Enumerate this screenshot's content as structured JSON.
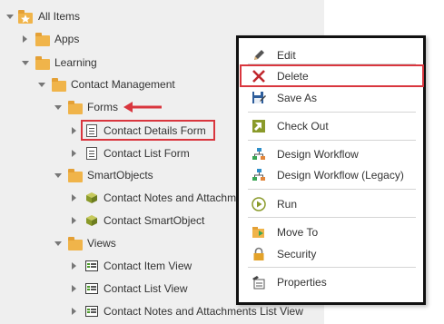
{
  "tree": {
    "root": {
      "label": "All Items",
      "icon": "star-folder-icon"
    },
    "apps": {
      "label": "Apps",
      "icon": "folder-icon"
    },
    "learning": {
      "label": "Learning",
      "icon": "folder-icon"
    },
    "contact_management": {
      "label": "Contact Management",
      "icon": "folder-icon"
    },
    "forms": {
      "label": "Forms",
      "icon": "folder-icon"
    },
    "contact_details_form": {
      "label": "Contact Details Form",
      "icon": "form-icon"
    },
    "contact_list_form": {
      "label": "Contact List Form",
      "icon": "form-icon"
    },
    "smartobjects": {
      "label": "SmartObjects",
      "icon": "folder-icon"
    },
    "contact_notes_so": {
      "label": "Contact Notes and Attachm",
      "icon": "smartobject-icon"
    },
    "contact_so": {
      "label": "Contact SmartObject",
      "icon": "smartobject-icon"
    },
    "views": {
      "label": "Views",
      "icon": "folder-icon"
    },
    "contact_item_view": {
      "label": "Contact Item View",
      "icon": "view-icon"
    },
    "contact_list_view": {
      "label": "Contact List View",
      "icon": "view-icon"
    },
    "contact_notes_list_view": {
      "label": "Contact Notes and Attachments List View",
      "icon": "view-icon"
    }
  },
  "context_menu": {
    "items": [
      {
        "label": "Edit",
        "icon": "pencil-icon"
      },
      {
        "label": "Delete",
        "icon": "delete-x-icon"
      },
      {
        "label": "Save As",
        "icon": "save-as-icon"
      },
      {
        "label": "Check Out",
        "icon": "check-out-icon"
      },
      {
        "label": "Design Workflow",
        "icon": "workflow-icon"
      },
      {
        "label": "Design Workflow (Legacy)",
        "icon": "workflow-legacy-icon"
      },
      {
        "label": "Run",
        "icon": "run-icon"
      },
      {
        "label": "Move To",
        "icon": "move-to-icon"
      },
      {
        "label": "Security",
        "icon": "lock-icon"
      },
      {
        "label": "Properties",
        "icon": "properties-icon"
      }
    ]
  },
  "colors": {
    "highlight": "#d9363e",
    "tree_background": "#efefef",
    "folder": "#f0b44a"
  }
}
